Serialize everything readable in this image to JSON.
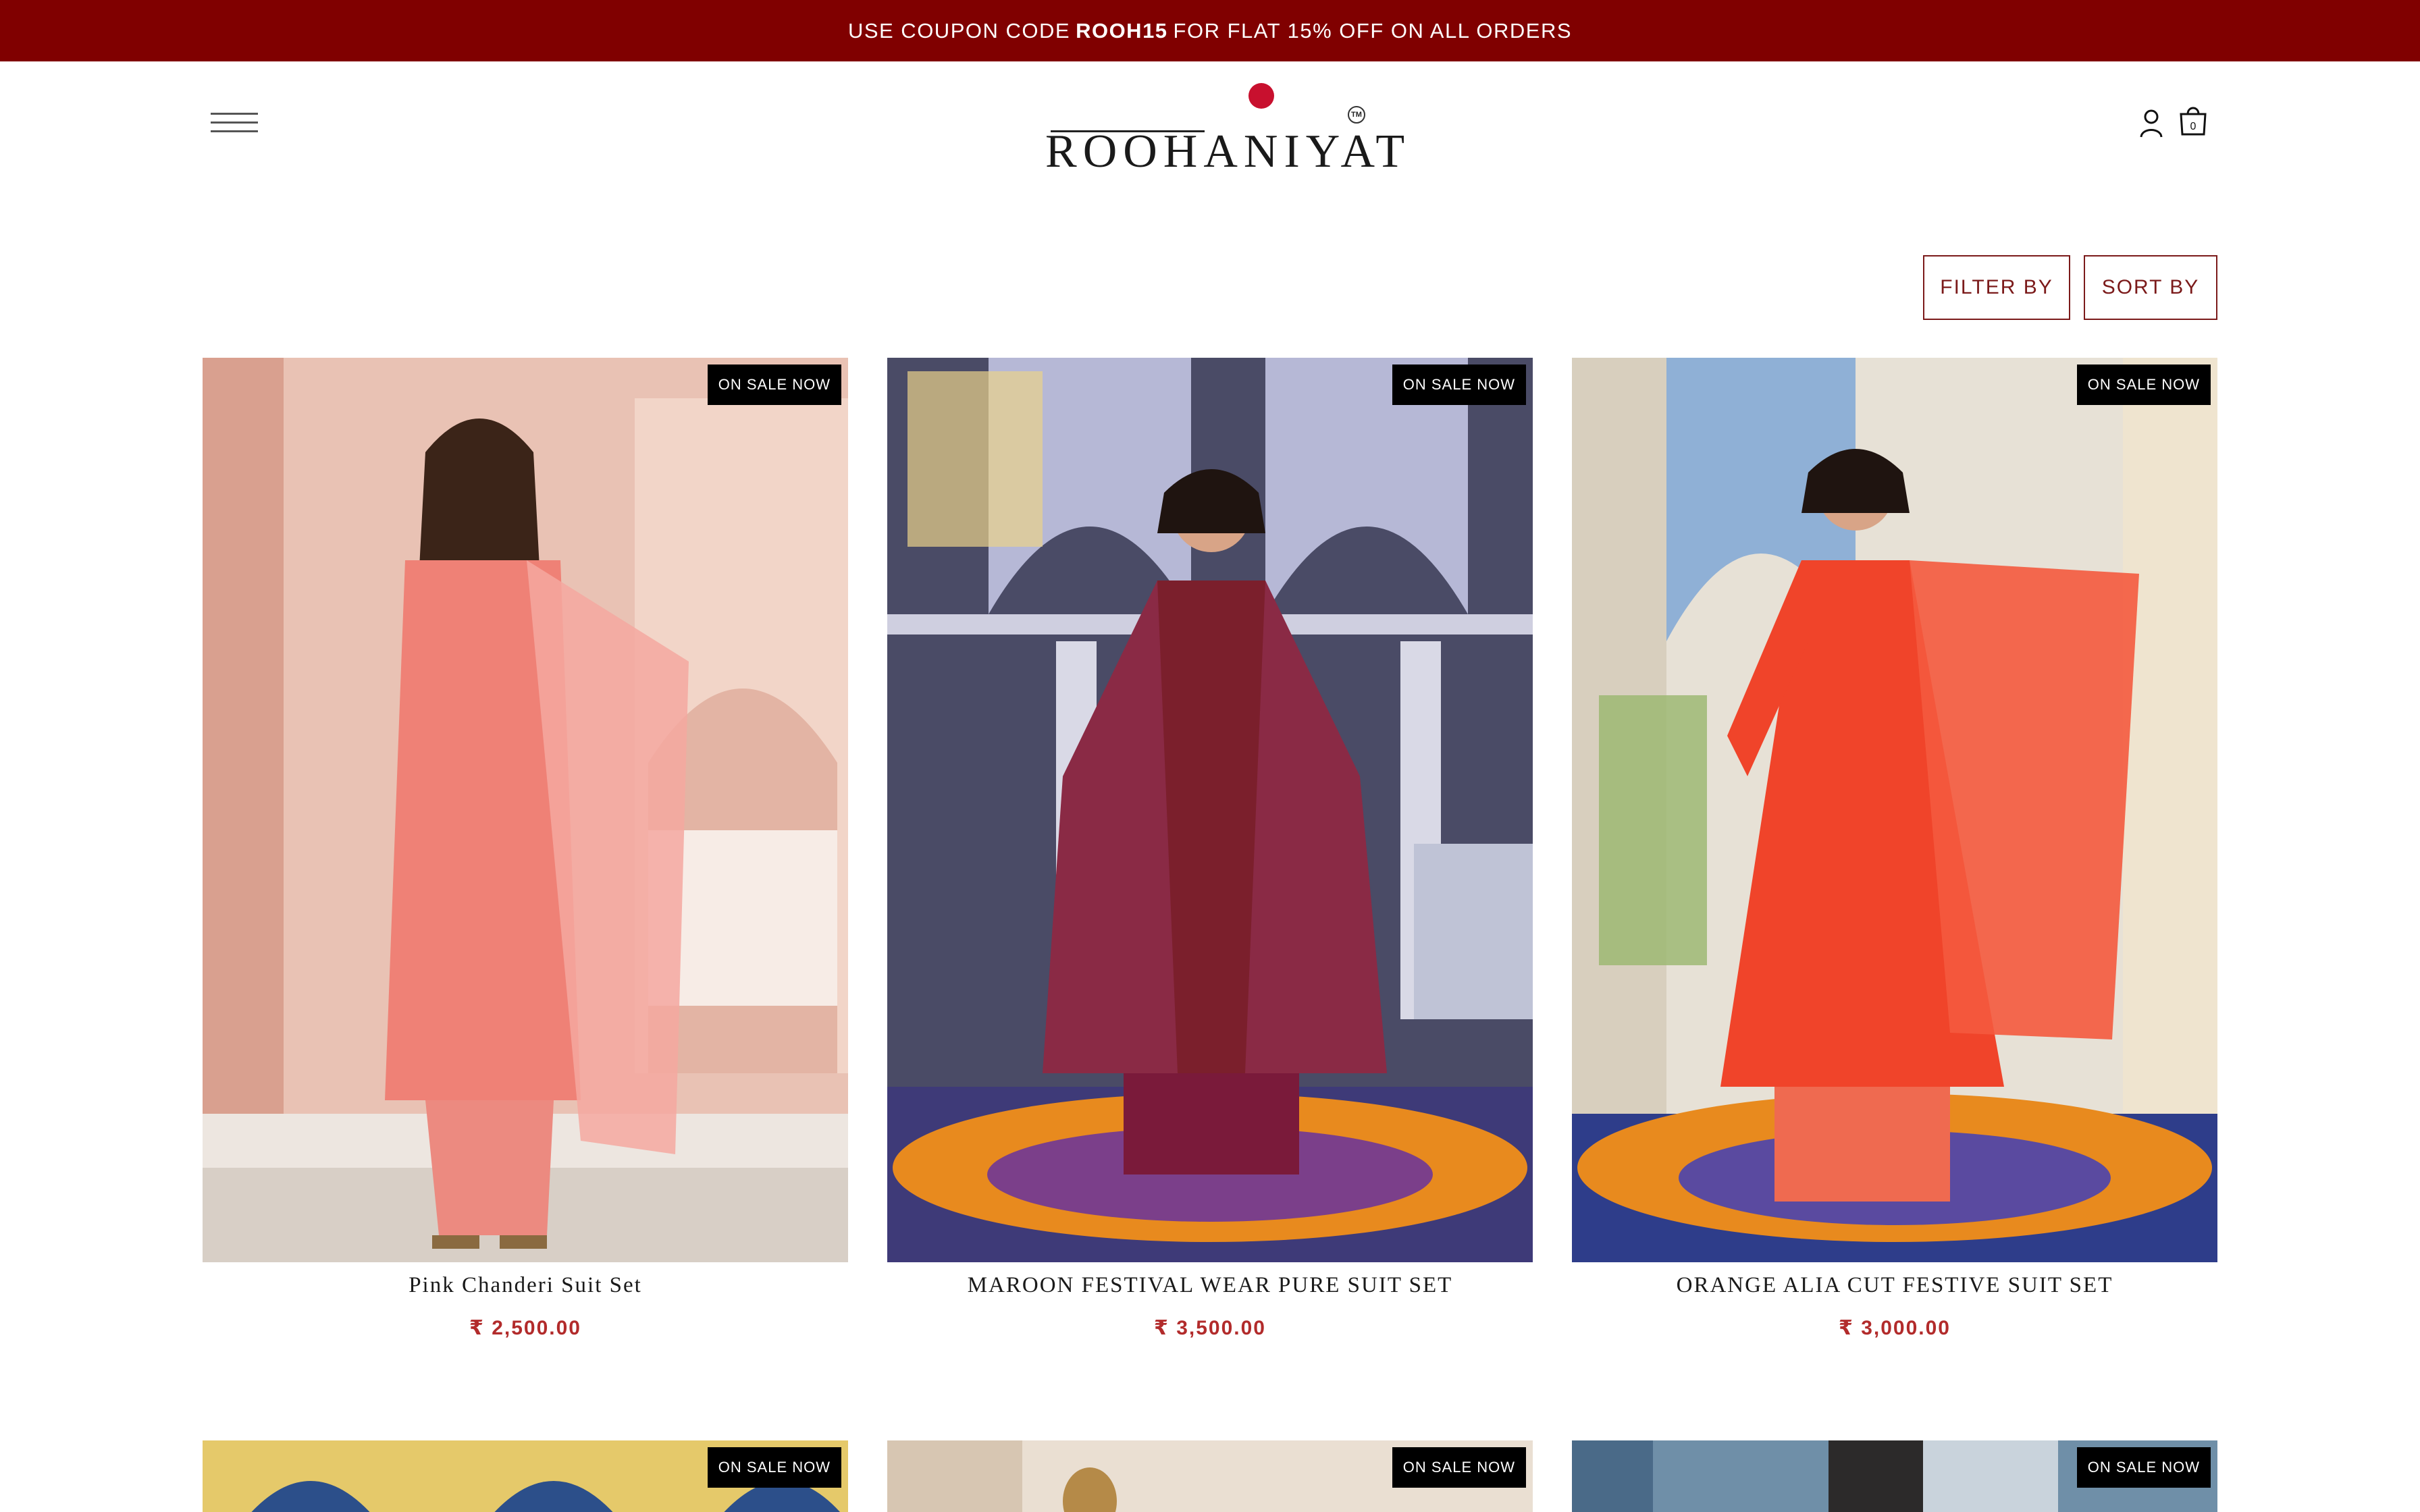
{
  "announcement": {
    "prefix": "USE COUPON CODE",
    "code": "ROOH15",
    "suffix": "FOR FLAT 15% OFF ON ALL ORDERS",
    "background": "#800000"
  },
  "header": {
    "menu_icon": "hamburger-icon",
    "logo_text": "ROOHANIYAT",
    "logo_tm": "TM",
    "account_icon": "user-icon",
    "cart_icon": "shopping-bag-icon",
    "cart_count": "0"
  },
  "toolbar": {
    "filter_label": "FILTER BY",
    "sort_label": "SORT BY",
    "accent": "#7b1a1a"
  },
  "products": [
    {
      "badge": "ON SALE NOW",
      "title": "Pink Chanderi Suit Set",
      "price": "₹ 2,500.00"
    },
    {
      "badge": "ON SALE NOW",
      "title": "MAROON FESTIVAL WEAR PURE SUIT SET",
      "price": "₹ 3,500.00"
    },
    {
      "badge": "ON SALE NOW",
      "title": "ORANGE ALIA CUT FESTIVE SUIT SET",
      "price": "₹ 3,000.00"
    },
    {
      "badge": "ON SALE NOW"
    },
    {
      "badge": "ON SALE NOW"
    },
    {
      "badge": "ON SALE NOW"
    }
  ],
  "colors": {
    "price": "#b22b2b",
    "badge_bg": "#000000"
  }
}
